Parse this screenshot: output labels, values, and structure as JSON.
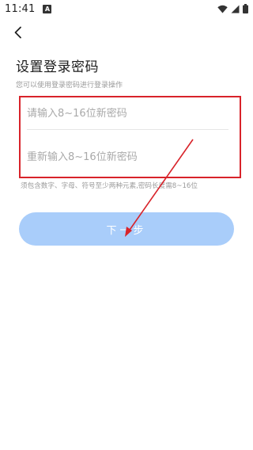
{
  "status_bar": {
    "time": "11:41",
    "notification_icon": "A"
  },
  "header": {
    "back_icon": "chevron-left-icon"
  },
  "form": {
    "title": "设置登录密码",
    "subtitle": "您可以使用登录密码进行登录操作",
    "password_placeholder": "请输入8~16位新密码",
    "confirm_placeholder": "重新输入8~16位新密码",
    "hint": "须包含数字、字母、符号至少两种元素,密码长度需8~16位",
    "next_label": "下一步"
  },
  "colors": {
    "button_bg": "#a9cdfa",
    "annotation_red": "#d8232a"
  }
}
